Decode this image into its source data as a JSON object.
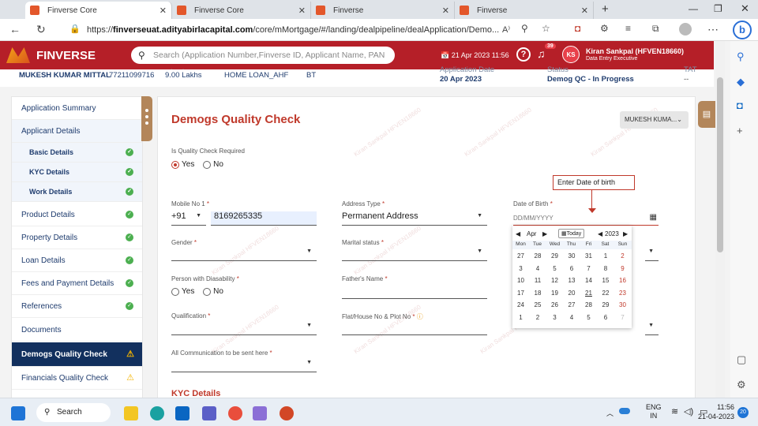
{
  "browser": {
    "tabs": [
      {
        "title": "Finverse Core",
        "active": true
      },
      {
        "title": "Finverse Core",
        "active": false
      },
      {
        "title": "Finverse",
        "active": false
      },
      {
        "title": "Finverse",
        "active": false
      }
    ],
    "url_prefix": "https://",
    "url_host": "finverseuat.adityabirlacapital.com",
    "url_path": "/core/mMortgage/#/landing/dealpipeline/dealApplication/Demo..."
  },
  "header": {
    "brand": "FINVERSE",
    "search_placeholder": "Search (Application Number,Finverse ID, Applicant Name, PAN Number)",
    "datetime": "21 Apr 2023 11:56",
    "notif_count": "39",
    "user_initials": "KS",
    "user_name": "Kiran Sankpal (HFVEN18660)",
    "user_role": "Data Entry Executive"
  },
  "info": {
    "name": "MUKESH KUMAR MITTAL",
    "phone": "77211099716",
    "amount": "9.00 Lakhs",
    "product": "HOME LOAN_AHF",
    "bt": "BT",
    "app_date_label": "Application Date",
    "app_date": "20 Apr 2023",
    "status_label": "Status",
    "status": "Demog QC - In Progress",
    "tat_label": "TAT",
    "tat": "--"
  },
  "sidebar": [
    {
      "label": "Application Summary",
      "state": "none"
    },
    {
      "label": "Applicant Details",
      "state": "none"
    },
    {
      "label": "Basic Details",
      "state": "done"
    },
    {
      "label": "KYC Details",
      "state": "done"
    },
    {
      "label": "Work Details",
      "state": "done"
    },
    {
      "label": "Product Details",
      "state": "done"
    },
    {
      "label": "Property Details",
      "state": "done"
    },
    {
      "label": "Loan Details",
      "state": "done"
    },
    {
      "label": "Fees and Payment Details",
      "state": "done"
    },
    {
      "label": "References",
      "state": "done"
    },
    {
      "label": "Documents",
      "state": "none"
    },
    {
      "label": "Demogs Quality Check",
      "state": "warn"
    },
    {
      "label": "Financials Quality Check",
      "state": "warn"
    }
  ],
  "form": {
    "title": "Demogs Quality Check",
    "applicant_chip": "MUKESH KUMA...",
    "qc_required_label": "Is Quality Check Required",
    "yes": "Yes",
    "no": "No",
    "mobile_label": "Mobile No 1",
    "mobile_code": "+91",
    "mobile_value": "8169265335",
    "address_type_label": "Address Type",
    "address_type_value": "Permanent Address",
    "dob_label": "Date of Birth",
    "dob_placeholder": "DD/MM/YYYY",
    "gender_label": "Gender",
    "marital_label": "Marital status",
    "disability_label": "Person with Diasability",
    "father_label": "Father's Name",
    "qualification_label": "Qualification",
    "flat_label": "Flat/House No & Plot No",
    "comm_label": "All Communication to be sent here",
    "kyc_heading": "KYC Details",
    "req": "*"
  },
  "callout": "Enter Date of birth",
  "calendar": {
    "month": "Apr",
    "today": "Today",
    "year": "2023",
    "weekdays": [
      "Mon",
      "Tue",
      "Wed",
      "Thu",
      "Fri",
      "Sat",
      "Sun"
    ],
    "weeks": [
      [
        "27",
        "28",
        "29",
        "30",
        "31",
        "1",
        "2"
      ],
      [
        "3",
        "4",
        "5",
        "6",
        "7",
        "8",
        "9"
      ],
      [
        "10",
        "11",
        "12",
        "13",
        "14",
        "15",
        "16"
      ],
      [
        "17",
        "18",
        "19",
        "20",
        "21",
        "22",
        "23"
      ],
      [
        "24",
        "25",
        "26",
        "27",
        "28",
        "29",
        "30"
      ],
      [
        "1",
        "2",
        "3",
        "4",
        "5",
        "6",
        "7"
      ]
    ]
  },
  "watermark": "Kiran Sankpal HFVEN18660",
  "taskbar": {
    "search": "Search",
    "lang": "ENG",
    "region": "IN",
    "time": "11:56",
    "date": "21-04-2023",
    "badge": "20"
  }
}
